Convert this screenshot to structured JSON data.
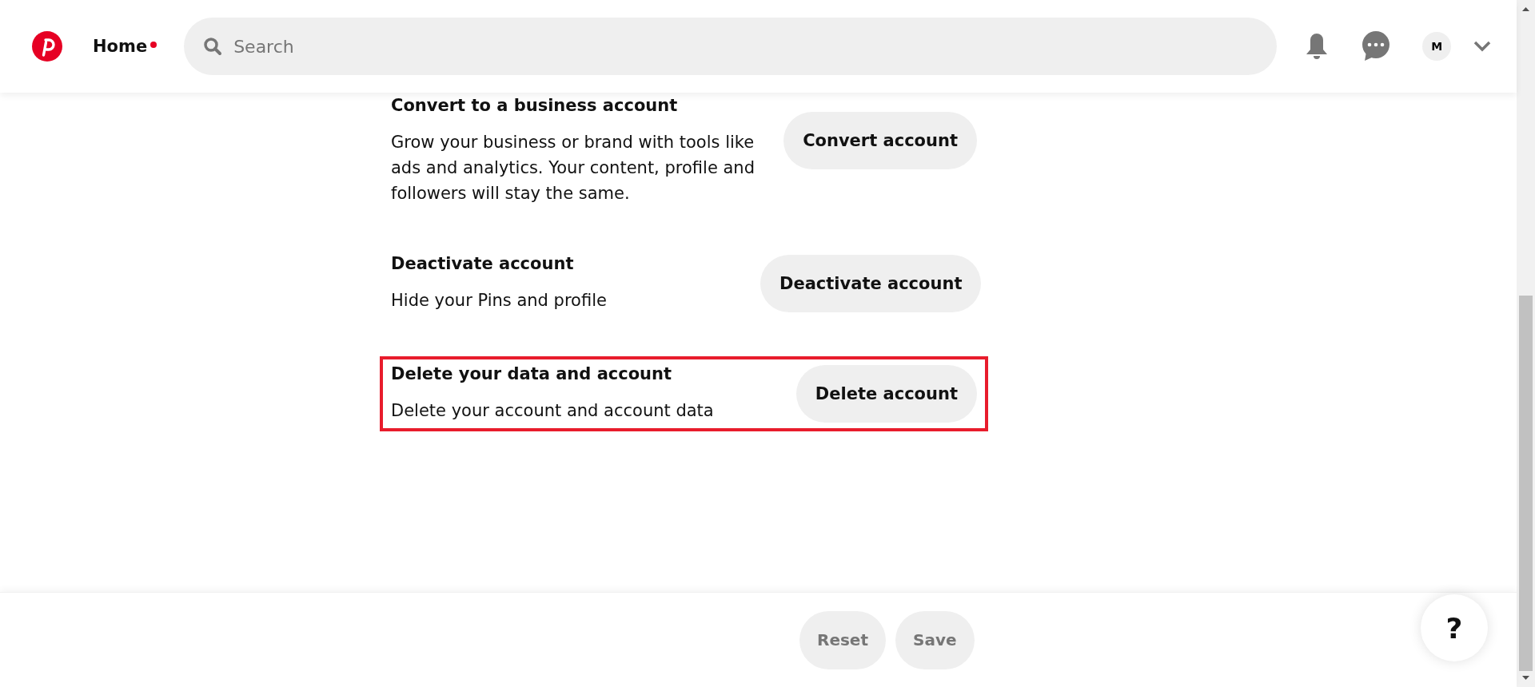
{
  "header": {
    "home": {
      "label": "Home",
      "notification_dot": true
    },
    "search": {
      "placeholder": "Search"
    },
    "avatar": {
      "initial": "M"
    }
  },
  "sections": [
    {
      "title": "Convert to a business account",
      "description": "Grow your business or brand with tools like ads and analytics. Your content, profile and followers will stay the same.",
      "button": "Convert account",
      "highlighted": false
    },
    {
      "title": "Deactivate account",
      "description": "Hide your Pins and profile",
      "button": "Deactivate account",
      "highlighted": false
    },
    {
      "title": "Delete your data and account",
      "description": "Delete your account and account data",
      "button": "Delete account",
      "highlighted": true
    }
  ],
  "footer": {
    "buttons": [
      {
        "label": "Reset",
        "disabled": true
      },
      {
        "label": "Save",
        "disabled": true
      }
    ],
    "help": "?"
  }
}
